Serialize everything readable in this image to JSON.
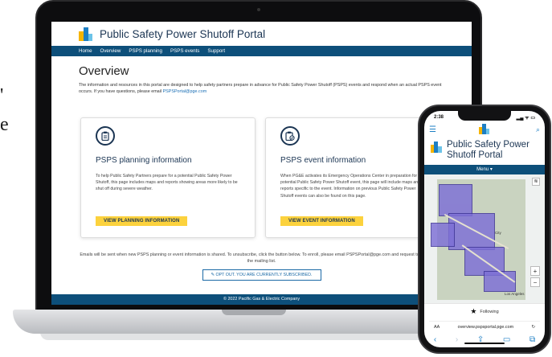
{
  "edge_text": {
    "line1": "'",
    "line2": "e"
  },
  "site": {
    "title": "Public Safety Power Shutoff Portal",
    "nav": [
      "Home",
      "Overview",
      "PSPS planning",
      "PSPS events",
      "Support"
    ],
    "heading": "Overview",
    "intro_text": "The information and resources in this portal are designed to help safety partners prepare in advance for Public Safety Power Shutoff (PSPS) events and respond when an actual PSPS event occurs. If you have questions, please email",
    "intro_email": "PSPSPortal@pge.com",
    "cards": [
      {
        "icon": "clipboard-icon",
        "title": "PSPS planning information",
        "body": "To help Public Safety Partners prepare for a potential Public Safety Power Shutoff, this page includes maps and reports showing areas more likely to be shut off during severe weather.",
        "button": "VIEW PLANNING INFORMATION"
      },
      {
        "icon": "clipboard-check-icon",
        "title": "PSPS event information",
        "body": "When PG&E activates its Emergency Operations Center in preparation for a potential Public Safety Power Shutoff event, this page will include maps and reports specific to the event. Information on previous Public Safety Power Shutoff events can also be found on this page.",
        "button": "VIEW EVENT INFORMATION"
      }
    ],
    "emails_text": "Emails will be sent when new PSPS planning or event information is shared. To unsubscribe, click the button below. To enroll, please email PSPSPortal@pge.com and request to be added to the mailing list.",
    "optout_button": "✎ OPT OUT. YOU ARE CURRENTLY SUBSCRIBED.",
    "footer": "© 2022 Pacific Gas & Electric Company"
  },
  "phone": {
    "time": "2:38",
    "status_icons": "▂▄ ᯤ ▭",
    "title": "Public Safety Power Shutoff Portal",
    "menu": "Menu ▾",
    "map_labels": [
      "City",
      "Los Angeles"
    ],
    "following": "Following",
    "url_aa": "AA",
    "url": "overview.pspsportal.pge.com",
    "reload": "↻"
  },
  "colors": {
    "brand_navy": "#0d4f7a",
    "brand_blue": "#1d7fc4",
    "button_yellow": "#fcd23d",
    "map_polygon": "#7d6fd6"
  }
}
